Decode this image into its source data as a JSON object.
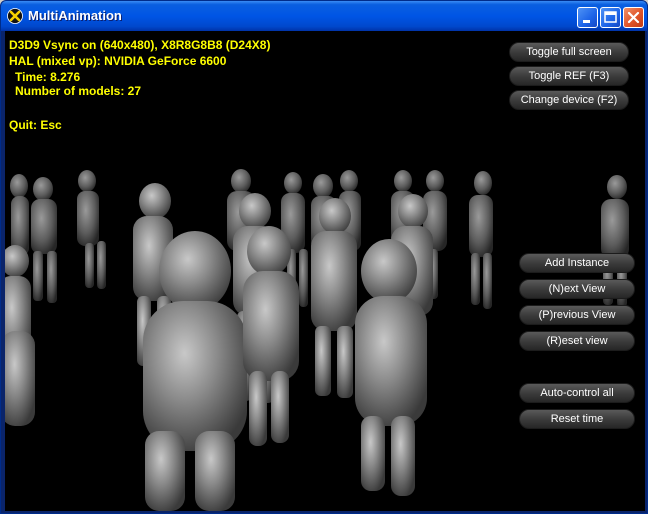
{
  "window": {
    "title": "MultiAnimation",
    "icon": "directx-x-icon"
  },
  "hud": {
    "line1": "D3D9 Vsync on (640x480), X8R8G8B8 (D24X8)",
    "line2": "HAL (mixed vp): NVIDIA GeForce 6600",
    "time": "Time: 8.276",
    "models": "Number of models: 27",
    "quit": "Quit: Esc",
    "text_color": "#ffff00"
  },
  "buttons": {
    "toggle_full_screen": "Toggle full screen",
    "toggle_ref": "Toggle REF (F3)",
    "change_device": "Change device (F2)",
    "add_instance": "Add Instance",
    "next_view": "(N)ext View",
    "previous_view": "(P)revious View",
    "reset_view": "(R)eset view",
    "auto_control_all": "Auto-control all",
    "reset_time": "Reset time"
  },
  "colors": {
    "titlebar": "#0055e5",
    "viewport_bg": "#000000",
    "close_button": "#e0542a"
  }
}
